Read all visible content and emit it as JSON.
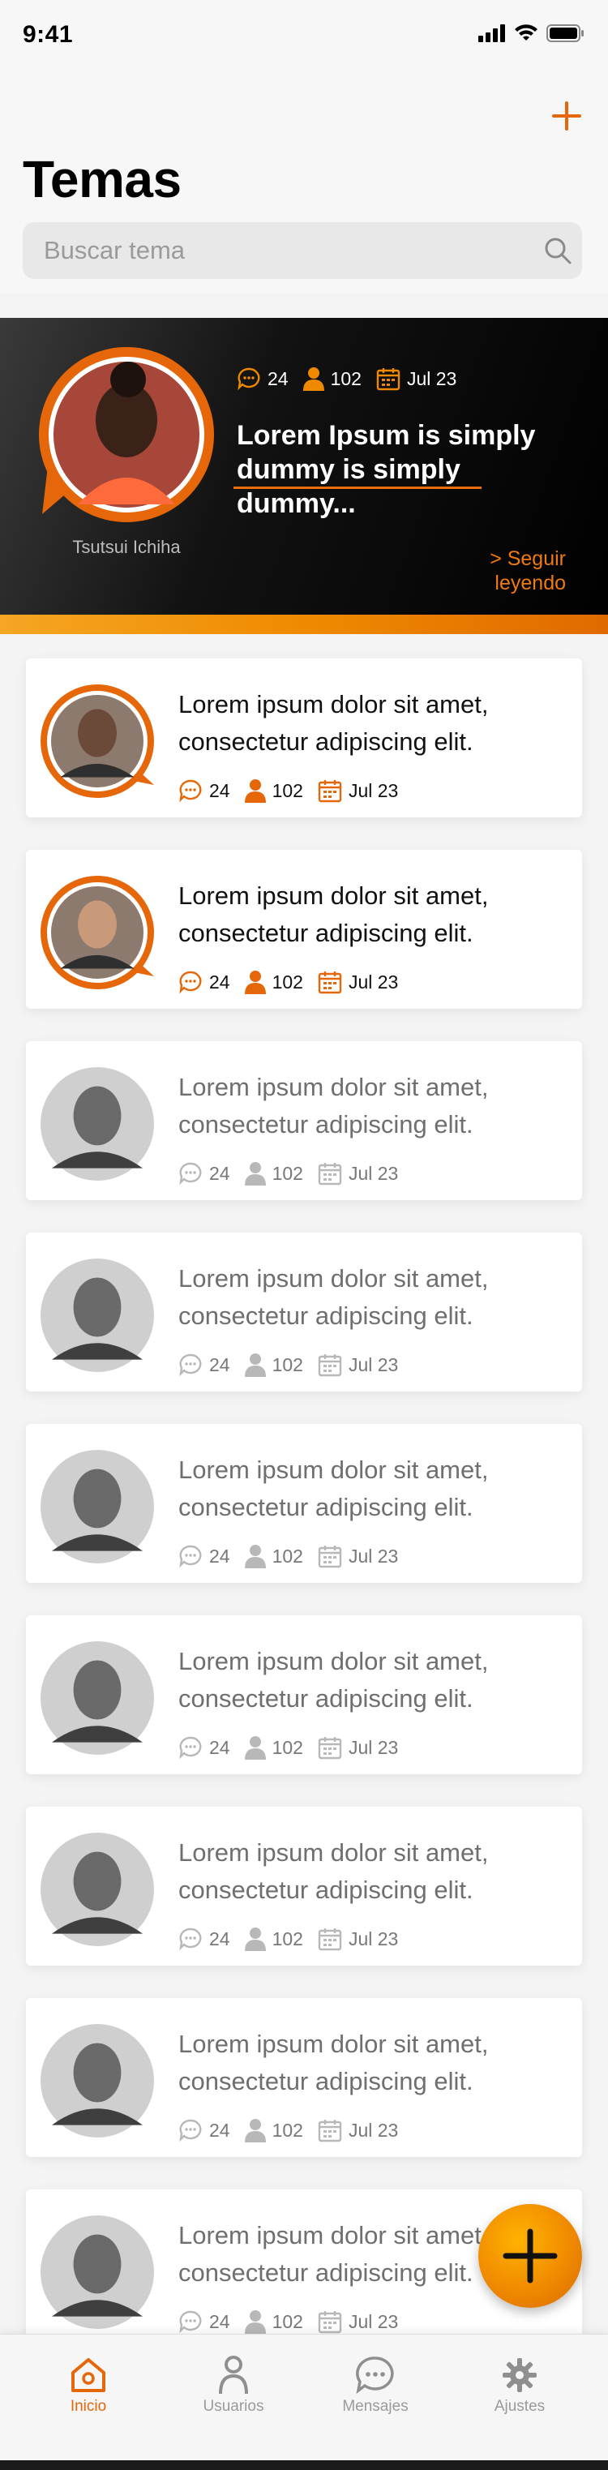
{
  "status_bar": {
    "time": "9:41"
  },
  "header": {
    "title": "Temas"
  },
  "search": {
    "placeholder": "Buscar tema"
  },
  "featured": {
    "comments": "24",
    "users": "102",
    "date": "Jul 23",
    "title": "Lorem Ipsum is simply dummy  is simply dummy...",
    "author": "Tsutsui Ichiha",
    "read_more": "> Seguir leyendo"
  },
  "topics": [
    {
      "title": "Lorem ipsum dolor sit amet, consectetur adipiscing elit.",
      "comments": "24",
      "users": "102",
      "date": "Jul 23",
      "unread": true
    },
    {
      "title": "Lorem ipsum dolor sit amet, consectetur adipiscing elit.",
      "comments": "24",
      "users": "102",
      "date": "Jul 23",
      "unread": true
    },
    {
      "title": "Lorem ipsum dolor sit amet, consectetur adipiscing elit.",
      "comments": "24",
      "users": "102",
      "date": "Jul 23",
      "unread": false
    },
    {
      "title": "Lorem ipsum dolor sit amet, consectetur adipiscing elit.",
      "comments": "24",
      "users": "102",
      "date": "Jul 23",
      "unread": false
    },
    {
      "title": "Lorem ipsum dolor sit amet, consectetur adipiscing elit.",
      "comments": "24",
      "users": "102",
      "date": "Jul 23",
      "unread": false
    },
    {
      "title": "Lorem ipsum dolor sit amet, consectetur adipiscing elit.",
      "comments": "24",
      "users": "102",
      "date": "Jul 23",
      "unread": false
    },
    {
      "title": "Lorem ipsum dolor sit amet, consectetur adipiscing elit.",
      "comments": "24",
      "users": "102",
      "date": "Jul 23",
      "unread": false
    },
    {
      "title": "Lorem ipsum dolor sit amet, consectetur adipiscing elit.",
      "comments": "24",
      "users": "102",
      "date": "Jul 23",
      "unread": false
    },
    {
      "title": "Lorem ipsum dolor sit amet, consectetur adipiscing elit.",
      "comments": "24",
      "users": "102",
      "date": "Jul 23",
      "unread": false
    }
  ],
  "tabbar": {
    "items": [
      {
        "label": "Inicio",
        "icon": "home-icon",
        "active": true
      },
      {
        "label": "Usuarios",
        "icon": "user-icon",
        "active": false
      },
      {
        "label": "Mensajes",
        "icon": "chat-bubble-icon",
        "active": false
      },
      {
        "label": "Ajustes",
        "icon": "gear-icon",
        "active": false
      }
    ]
  },
  "colors": {
    "accent": "#e5670a",
    "accent_light": "#f5a623",
    "featured_bg": "#000000"
  }
}
